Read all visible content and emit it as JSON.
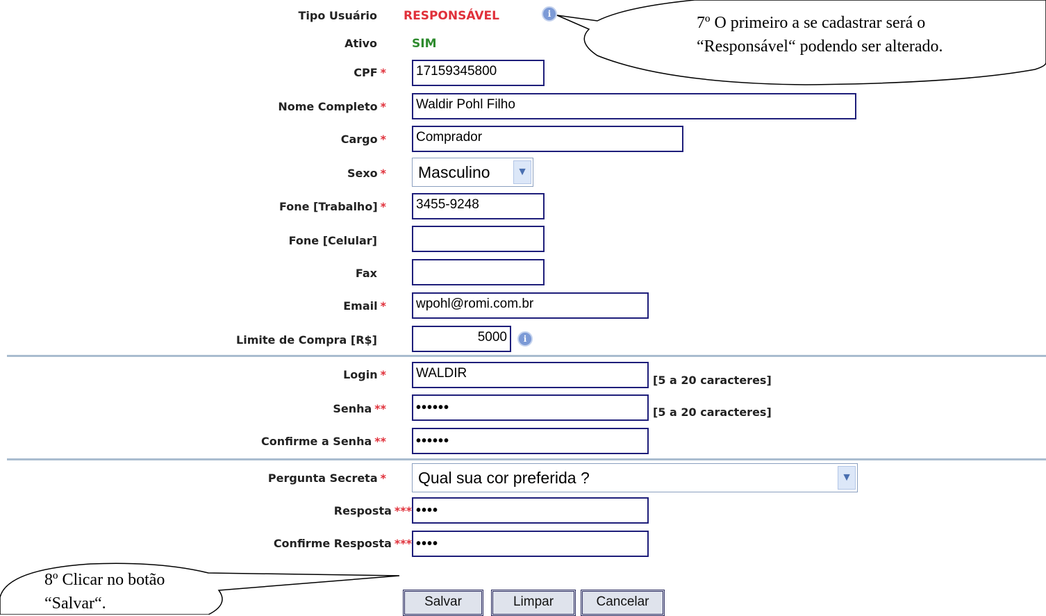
{
  "form": {
    "tipo_usuario_label": "Tipo Usuário",
    "tipo_usuario_value": "RESPONSÁVEL",
    "ativo_label": "Ativo",
    "ativo_value": "SIM",
    "cpf_label": "CPF",
    "cpf_value": "17159345800",
    "nome_label": "Nome Completo",
    "nome_value": "Waldir Pohl Filho",
    "cargo_label": "Cargo",
    "cargo_value": "Comprador",
    "sexo_label": "Sexo",
    "sexo_value": "Masculino",
    "fone_trab_label": "Fone [Trabalho]",
    "fone_trab_value": "3455-9248",
    "fone_cel_label": "Fone [Celular]",
    "fone_cel_value": "",
    "fax_label": "Fax",
    "fax_value": "",
    "email_label": "Email",
    "email_value": "wpohl@romi.com.br",
    "limite_label": "Limite de Compra [R$]",
    "limite_value": "5000",
    "login_label": "Login",
    "login_value": "WALDIR",
    "login_hint": "[5 a 20 caracteres]",
    "senha_label": "Senha",
    "senha_value": "••••••",
    "senha_hint": "[5 a 20 caracteres]",
    "confirme_senha_label": "Confirme a Senha",
    "confirme_senha_value": "••••••",
    "pergunta_label": "Pergunta Secreta",
    "pergunta_value": "Qual sua cor preferida ?",
    "resposta_label": "Resposta",
    "resposta_value": "••••",
    "confirme_resposta_label": "Confirme Resposta",
    "confirme_resposta_value": "••••",
    "req1": "*",
    "req2": "**",
    "req3": "***",
    "info_glyph": "i"
  },
  "buttons": {
    "salvar": "Salvar",
    "limpar": "Limpar",
    "cancelar": "Cancelar"
  },
  "callouts": {
    "step7_line1": "7º O primeiro a se cadastrar será o",
    "step7_line2": "“Responsável“ podendo ser alterado.",
    "step8_line1": "8º Clicar no botão",
    "step8_line2": "“Salvar“."
  },
  "colors": {
    "responsavel": "#e0303a",
    "sim": "#2e8b2e",
    "required": "#e0303a",
    "input_border": "#1e1e7a"
  },
  "icons": {
    "info": "info-icon",
    "dropdown": "chevron-down-icon"
  }
}
